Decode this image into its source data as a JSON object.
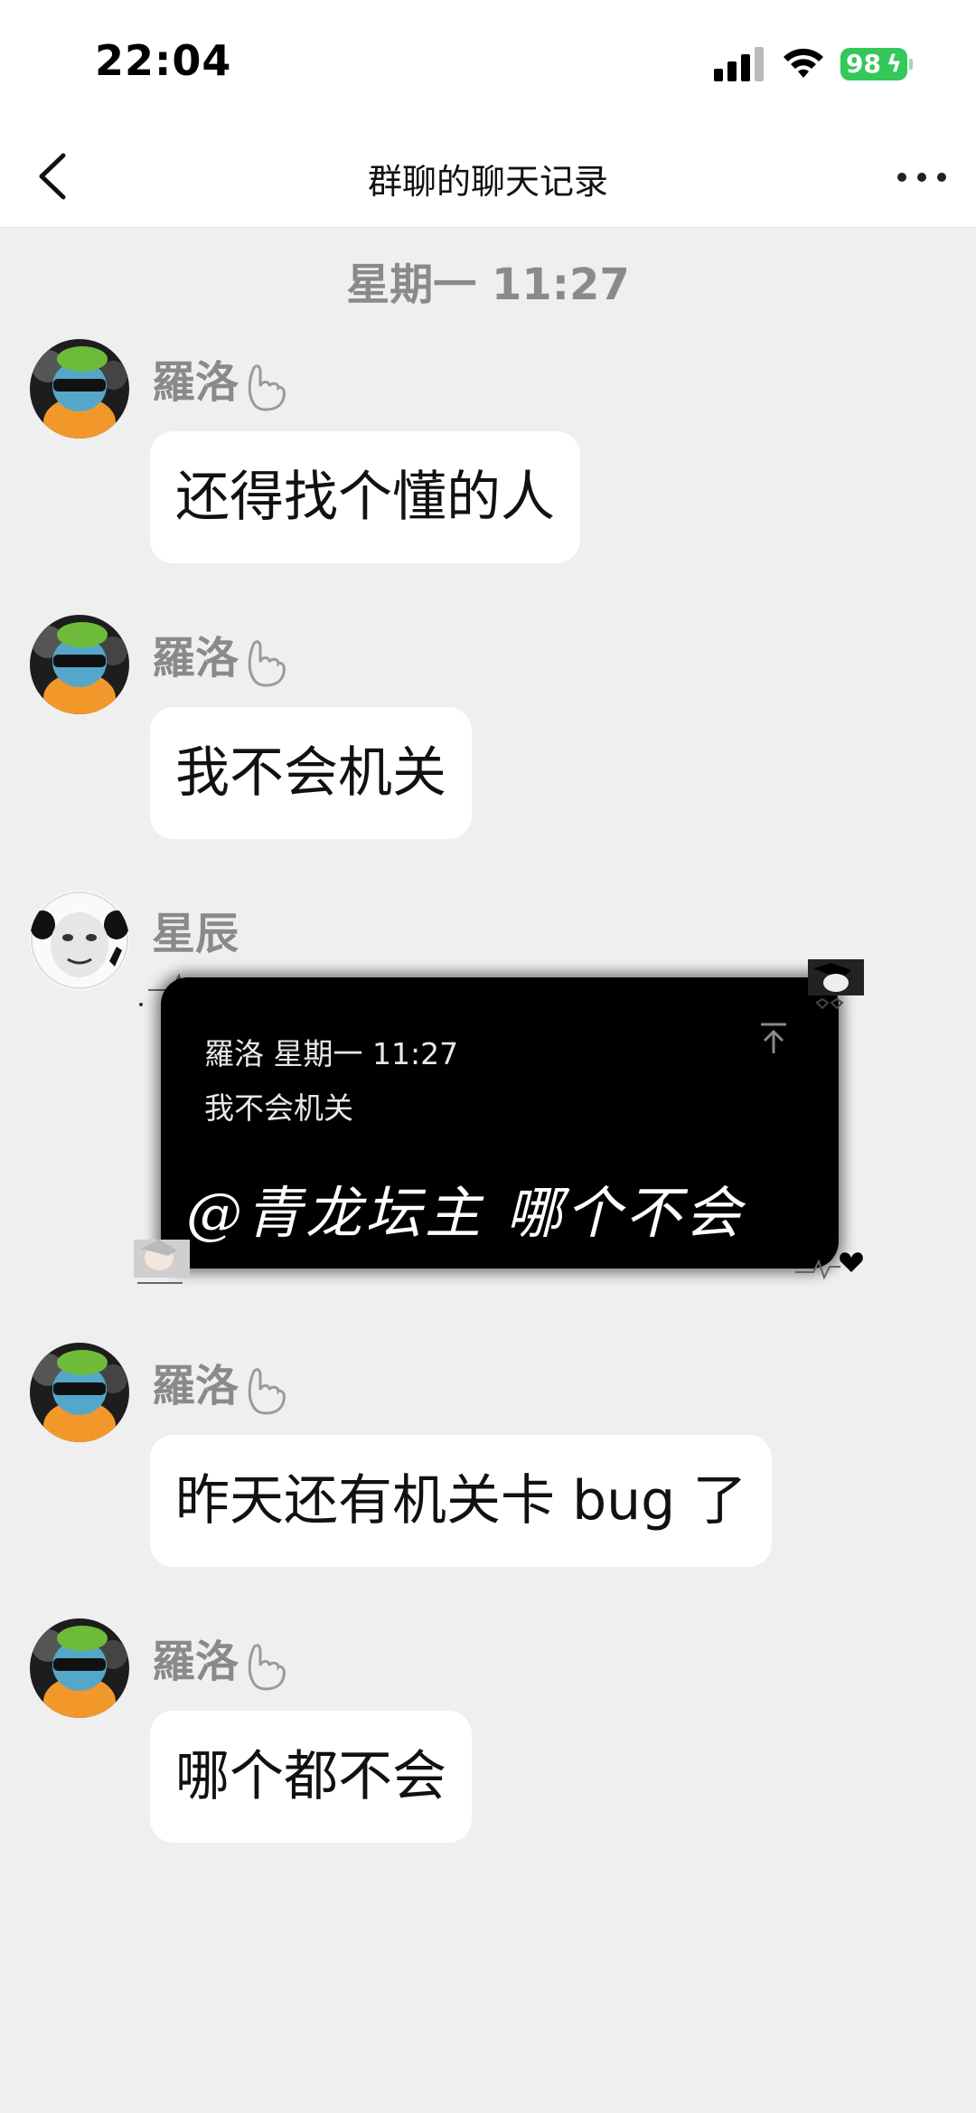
{
  "status_bar": {
    "time": "22:04",
    "battery": "98"
  },
  "nav": {
    "title": "群聊的聊天记录"
  },
  "timestamp": "星期一 11:27",
  "messages": [
    {
      "sender": "羅洛",
      "text": "还得找个懂的人"
    },
    {
      "sender": "羅洛",
      "text": "我不会机关"
    },
    {
      "sender": "星辰",
      "card": {
        "meta": "羅洛 星期一 11:27",
        "quote": "我不会机关",
        "text": "@青龙坛主 哪个不会"
      }
    },
    {
      "sender": "羅洛",
      "text": "昨天还有机关卡 bug 了"
    },
    {
      "sender": "羅洛",
      "text": "哪个都不会"
    }
  ],
  "icons": {
    "back": "chevron-left-icon",
    "more": "more-dots-icon",
    "signal": "cellular-signal-icon",
    "wifi": "wifi-icon",
    "battery": "battery-icon",
    "badge": "hand-badge-icon",
    "pin": "pin-top-icon"
  },
  "colors": {
    "background": "#efefef",
    "bubble": "#ffffff",
    "battery": "#34c759",
    "sender": "#8a8a8a"
  }
}
